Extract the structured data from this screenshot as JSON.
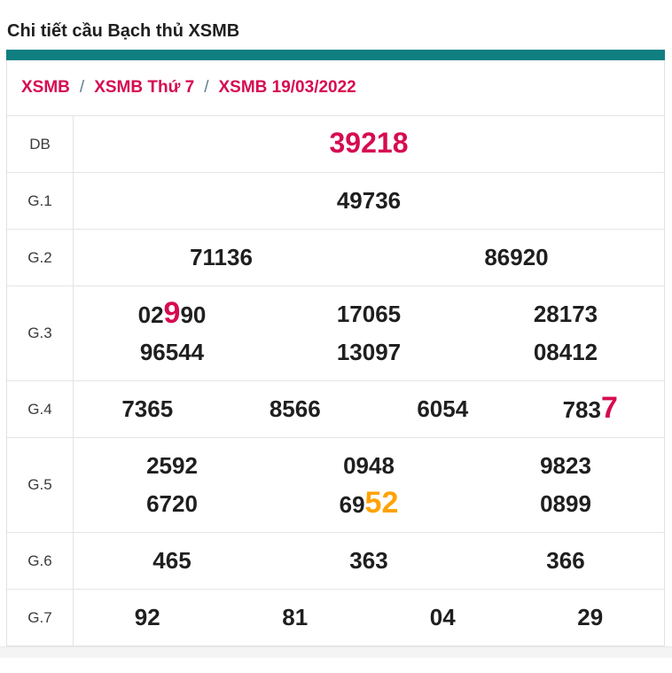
{
  "page": {
    "title": "Chi tiết cầu Bạch thủ XSMB"
  },
  "breadcrumb": {
    "separator": "/",
    "items": [
      {
        "label": "XSMB"
      },
      {
        "label": "XSMB Thứ 7"
      },
      {
        "label": "XSMB 19/03/2022"
      }
    ]
  },
  "colors": {
    "accent_teal": "#0f7f81",
    "crimson": "#d60b51",
    "highlight_orange": "#ffa200",
    "number_black": "#1f1f1f",
    "border_gray": "#e4e4e4",
    "footer_gray": "#f4f4f4"
  },
  "results_table": {
    "rows": [
      {
        "label": "DB",
        "lines": [
          [
            [
              {
                "t": "39218",
                "c": "db-red"
              }
            ]
          ]
        ]
      },
      {
        "label": "G.1",
        "lines": [
          [
            [
              {
                "t": "49736"
              }
            ]
          ]
        ]
      },
      {
        "label": "G.2",
        "lines": [
          [
            [
              {
                "t": "71136"
              }
            ],
            [
              {
                "t": "86920"
              }
            ]
          ]
        ]
      },
      {
        "label": "G.3",
        "lines": [
          [
            [
              {
                "t": "02"
              },
              {
                "t": "9",
                "c": "hl-red"
              },
              {
                "t": "90"
              }
            ],
            [
              {
                "t": "17065"
              }
            ],
            [
              {
                "t": "28173"
              }
            ]
          ],
          [
            [
              {
                "t": "96544"
              }
            ],
            [
              {
                "t": "13097"
              }
            ],
            [
              {
                "t": "08412"
              }
            ]
          ]
        ]
      },
      {
        "label": "G.4",
        "lines": [
          [
            [
              {
                "t": "7365"
              }
            ],
            [
              {
                "t": "8566"
              }
            ],
            [
              {
                "t": "6054"
              }
            ],
            [
              {
                "t": "783"
              },
              {
                "t": "7",
                "c": "hl-red"
              }
            ]
          ]
        ]
      },
      {
        "label": "G.5",
        "lines": [
          [
            [
              {
                "t": "2592"
              }
            ],
            [
              {
                "t": "0948"
              }
            ],
            [
              {
                "t": "9823"
              }
            ]
          ],
          [
            [
              {
                "t": "6720"
              }
            ],
            [
              {
                "t": "69"
              },
              {
                "t": "52",
                "c": "hl-orange"
              }
            ],
            [
              {
                "t": "0899"
              }
            ]
          ]
        ]
      },
      {
        "label": "G.6",
        "lines": [
          [
            [
              {
                "t": "465"
              }
            ],
            [
              {
                "t": "363"
              }
            ],
            [
              {
                "t": "366"
              }
            ]
          ]
        ]
      },
      {
        "label": "G.7",
        "lines": [
          [
            [
              {
                "t": "92"
              }
            ],
            [
              {
                "t": "81"
              }
            ],
            [
              {
                "t": "04"
              }
            ],
            [
              {
                "t": "29"
              }
            ]
          ]
        ]
      }
    ]
  }
}
